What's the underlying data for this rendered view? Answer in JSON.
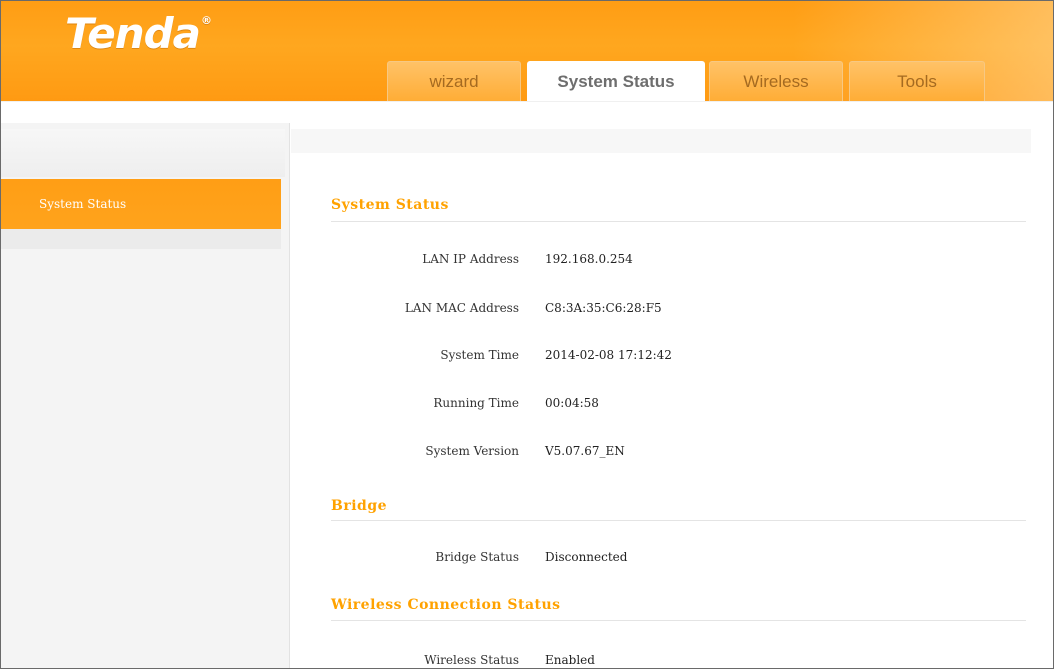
{
  "header": {
    "logo": "Tenda",
    "logo_mark": "®",
    "tabs": [
      {
        "label": "wizard"
      },
      {
        "label": "System Status"
      },
      {
        "label": "Wireless"
      },
      {
        "label": "Tools"
      }
    ],
    "active_tab": "System Status"
  },
  "sidebar": {
    "items": [
      {
        "label": "System Status"
      }
    ]
  },
  "main": {
    "system_status": {
      "title": "System Status",
      "rows": [
        {
          "label": "LAN IP Address",
          "value": "192.168.0.254"
        },
        {
          "label": "LAN MAC Address",
          "value": "C8:3A:35:C6:28:F5"
        },
        {
          "label": "System Time",
          "value": "2014-02-08 17:12:42"
        },
        {
          "label": "Running Time",
          "value": "00:04:58"
        },
        {
          "label": "System Version",
          "value": "V5.07.67_EN"
        }
      ]
    },
    "bridge": {
      "title": "Bridge",
      "rows": [
        {
          "label": "Bridge Status",
          "value": "Disconnected"
        }
      ]
    },
    "wireless": {
      "title": "Wireless Connection Status",
      "rows": [
        {
          "label": "Wireless Status",
          "value": "Enabled"
        }
      ]
    }
  },
  "colors": {
    "brand_orange": "#ff9d14",
    "section_title": "#ffa200"
  }
}
